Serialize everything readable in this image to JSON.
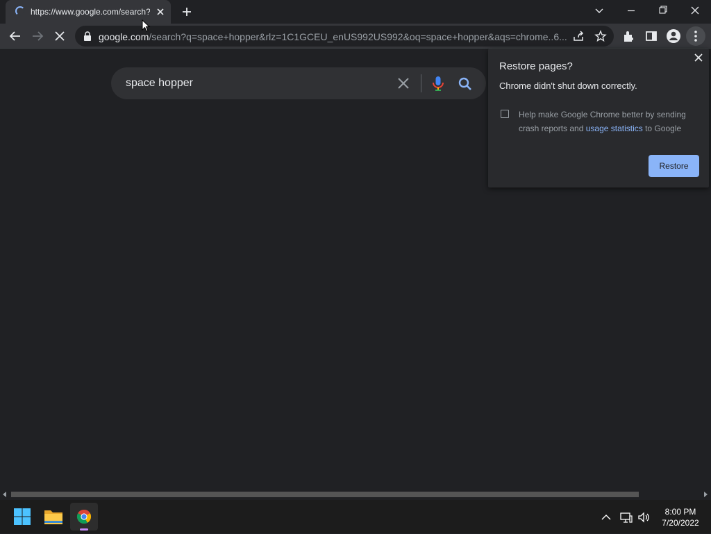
{
  "tab": {
    "title": "https://www.google.com/search?q=space+hopper",
    "close_icon": "close-icon",
    "new_tab_icon": "plus-icon"
  },
  "window_controls": {
    "tab_search_icon": "chevron-down-icon",
    "minimize_icon": "minimize-icon",
    "restore_icon": "restore-icon",
    "close_icon": "close-icon"
  },
  "toolbar": {
    "back_icon": "arrow-left-icon",
    "forward_icon": "arrow-right-icon",
    "stop_icon": "stop-icon",
    "url_host": "google.com",
    "url_rest": "/search?q=space+hopper&rlz=1C1GCEU_enUS992US992&oq=space+hopper&aqs=chrome..6...",
    "share_icon": "share-icon",
    "bookmark_icon": "star-icon",
    "extensions_icon": "puzzle-icon",
    "side_panel_icon": "side-panel-icon",
    "profile_icon": "person-icon",
    "menu_icon": "more-vertical-icon"
  },
  "search": {
    "query": "space hopper",
    "clear_icon": "close-icon",
    "mic_icon": "microphone-icon",
    "search_icon": "search-icon"
  },
  "restore_dialog": {
    "title": "Restore pages?",
    "message": "Chrome didn't shut down correctly.",
    "help_prefix": "Help make Google Chrome better by sending crash reports and ",
    "help_link": "usage statistics",
    "help_suffix": " to Google",
    "checkbox_checked": false,
    "restore_label": "Restore",
    "close_icon": "close-icon"
  },
  "taskbar": {
    "start_icon": "windows-icon",
    "explorer_icon": "folder-icon",
    "chrome_icon": "chrome-icon",
    "tray_chevron_icon": "chevron-up-icon",
    "network_icon": "network-icon",
    "volume_icon": "volume-icon",
    "time": "8:00 PM",
    "date": "7/20/2022"
  },
  "colors": {
    "background": "#202124",
    "toolbar": "#35363a",
    "accent": "#8ab4f8",
    "text": "#e8eaed"
  }
}
